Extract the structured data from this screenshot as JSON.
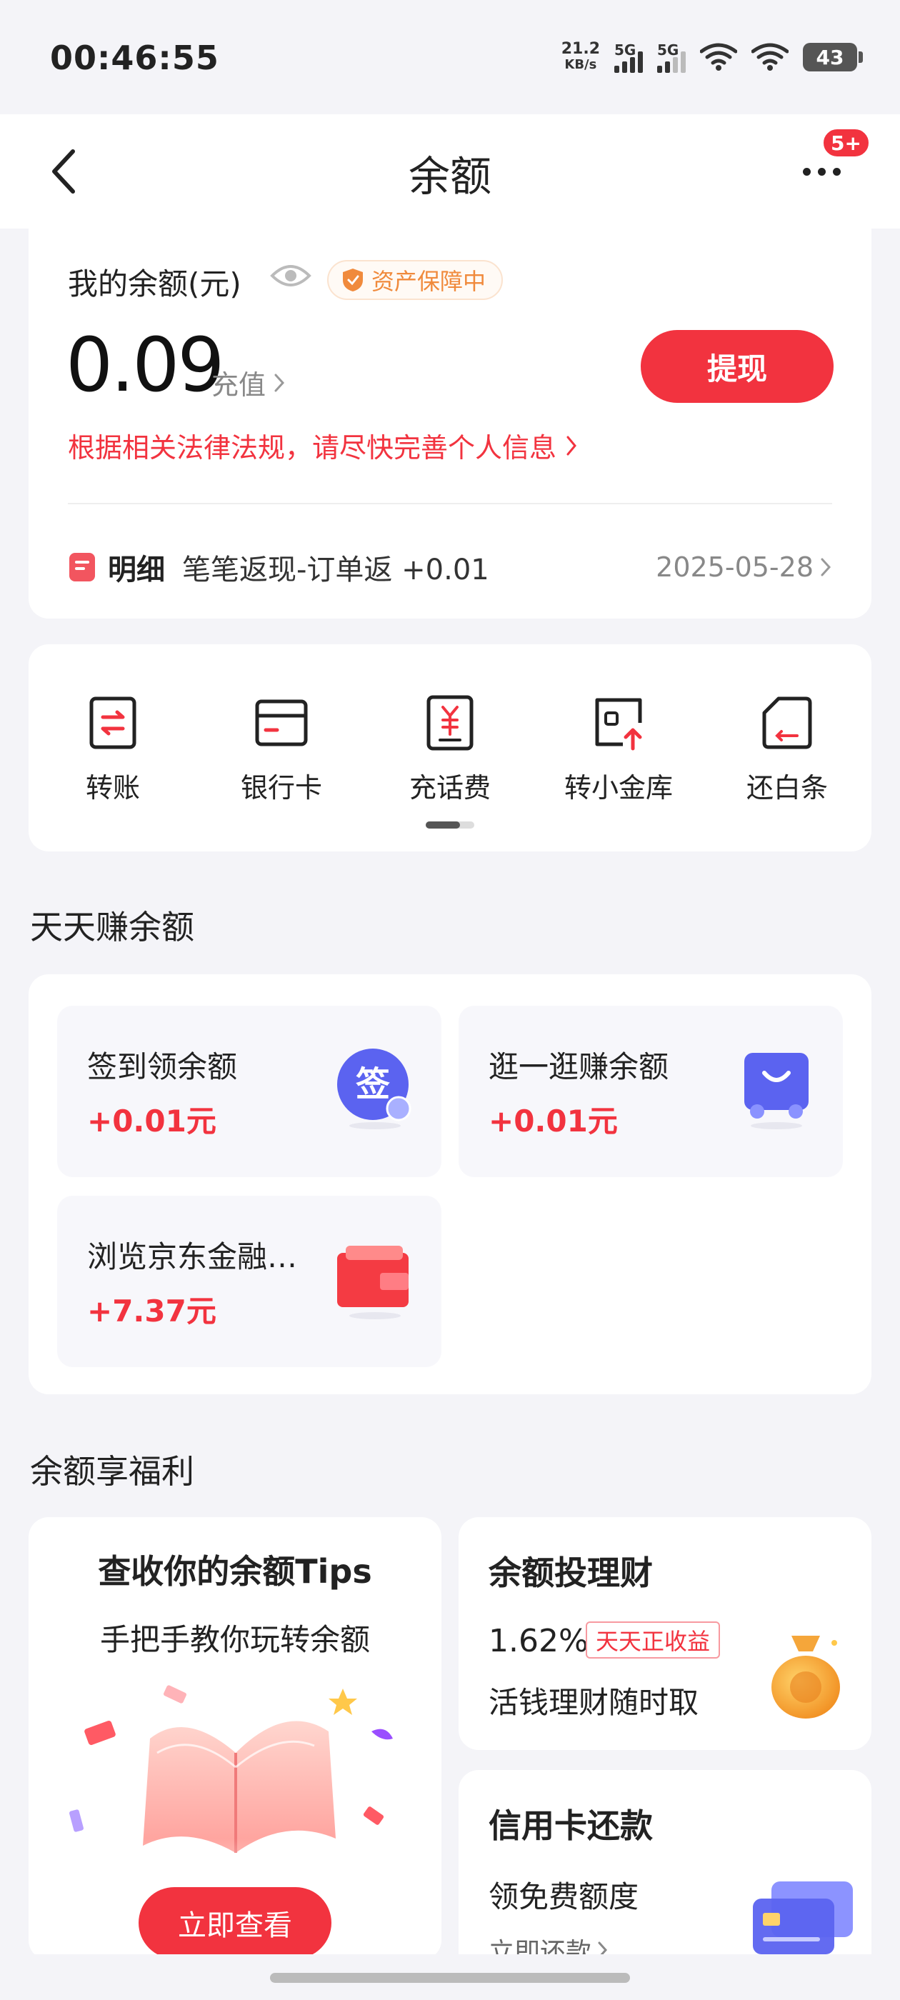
{
  "status_bar": {
    "time": "00:46:55",
    "net_speed_value": "21.2",
    "net_speed_unit": "KB/s",
    "signal_1_label": "5G",
    "signal_2_label": "5G",
    "battery": "43"
  },
  "header": {
    "title": "余额",
    "more_badge": "5+"
  },
  "balance": {
    "label": "我的余额(元)",
    "protection_tag": "资产保障中",
    "amount": "0.09",
    "recharge_label": "充值",
    "withdraw_label": "提现",
    "warning": "根据相关法律法规，请尽快完善个人信息",
    "detail_label": "明细",
    "detail_text": "笔笔返现-订单返 +0.01",
    "detail_date": "2025-05-28"
  },
  "tools": [
    {
      "label": "转账",
      "icon": "transfer-icon"
    },
    {
      "label": "银行卡",
      "icon": "bank-card-icon"
    },
    {
      "label": "充话费",
      "icon": "phone-recharge-icon"
    },
    {
      "label": "转小金库",
      "icon": "vault-transfer-icon"
    },
    {
      "label": "还白条",
      "icon": "repay-baitiao-icon"
    }
  ],
  "earn": {
    "title": "天天赚余额",
    "items": [
      {
        "title": "签到领余额",
        "amount": "+0.01元",
        "icon_text": "签"
      },
      {
        "title": "逛一逛赚余额",
        "amount": "+0.01元"
      },
      {
        "title": "浏览京东金融…",
        "amount": "+7.37元"
      }
    ]
  },
  "benefits": {
    "title": "余额享福利",
    "tips_title": "查收你的余额Tips",
    "tips_subtitle": "手把手教你玩转余额",
    "tips_button": "立即查看",
    "invest_title": "余额投理财",
    "invest_rate": "1.62%",
    "invest_tag": "天天正收益",
    "invest_desc": "活钱理财随时取",
    "credit_title": "信用卡还款",
    "credit_desc": "领免费额度",
    "credit_link": "立即还款"
  },
  "colors": {
    "accent": "#f2333f",
    "protection": "#f08a3c",
    "background": "#f4f4f8"
  }
}
